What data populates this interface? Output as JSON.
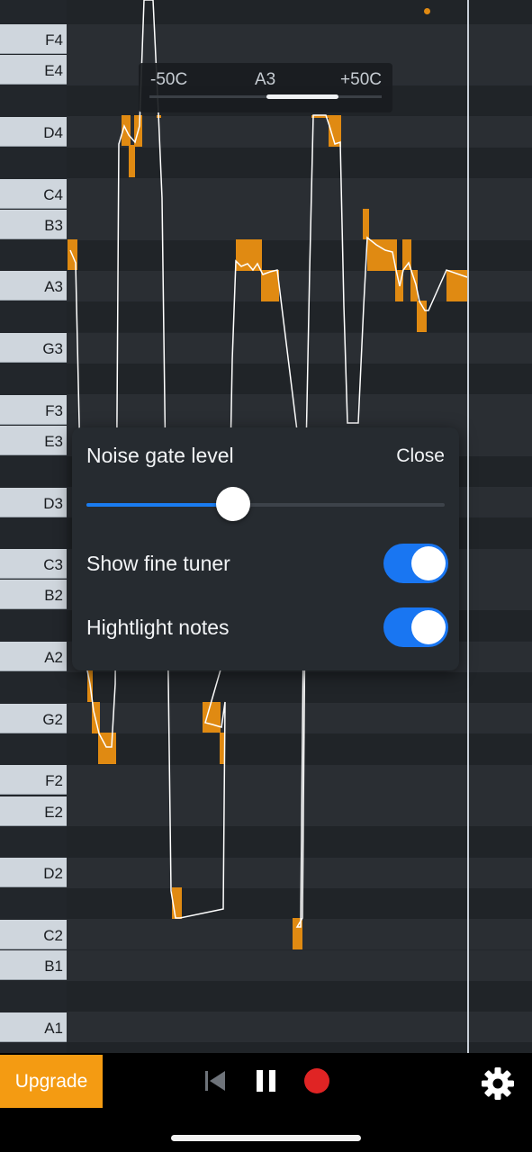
{
  "keys": [
    "F4",
    "E4",
    "D4",
    "C4",
    "B3",
    "A3",
    "G3",
    "F3",
    "E3",
    "D3",
    "C3",
    "B2",
    "A2",
    "G2",
    "F2",
    "E2",
    "D2",
    "C2",
    "B1",
    "A1"
  ],
  "fine_tuner": {
    "left": "-50C",
    "center": "A3",
    "right": "+50C"
  },
  "settings_panel": {
    "title": "Noise gate level",
    "close_label": "Close",
    "noise_gate_level": 0.41,
    "show_fine_tuner_label": "Show fine tuner",
    "show_fine_tuner": true,
    "highlight_notes_label": "Hightlight notes",
    "highlight_notes": true
  },
  "bottom_bar": {
    "upgrade_label": "Upgrade"
  },
  "icons": [
    "skip-back-icon",
    "pause-icon",
    "record-icon",
    "gear-icon"
  ],
  "colors": {
    "accent": "#f49b12",
    "note": "#e08a12",
    "toggle_on": "#1976f2",
    "record": "#e02424"
  }
}
